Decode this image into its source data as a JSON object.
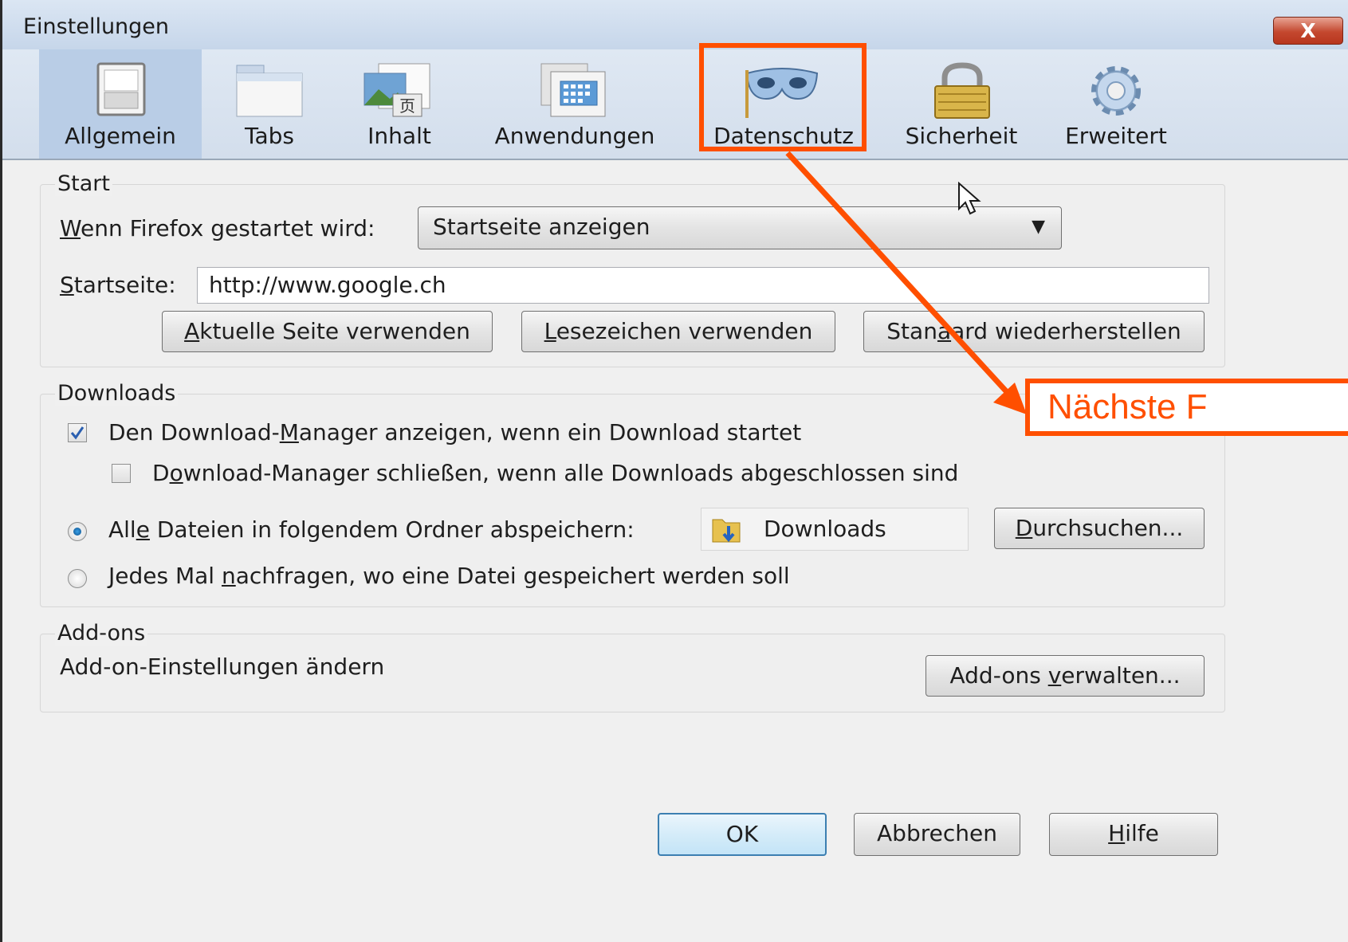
{
  "window": {
    "title": "Einstellungen",
    "close_label": "X"
  },
  "toolbar": {
    "tabs": [
      {
        "label": "Allgemein",
        "icon": "switch-icon",
        "selected": true
      },
      {
        "label": "Tabs",
        "icon": "tabs-window-icon",
        "selected": false
      },
      {
        "label": "Inhalt",
        "icon": "content-image-icon",
        "selected": false
      },
      {
        "label": "Anwendungen",
        "icon": "applications-calendar-icon",
        "selected": false
      },
      {
        "label": "Datenschutz",
        "icon": "privacy-mask-icon",
        "selected": false
      },
      {
        "label": "Sicherheit",
        "icon": "padlock-icon",
        "selected": false
      },
      {
        "label": "Erweitert",
        "icon": "gear-icon",
        "selected": false
      }
    ]
  },
  "start": {
    "legend": "Start",
    "when_label": "Wenn Firefox gestartet wird:",
    "when_value": "Startseite anzeigen",
    "homepage_label": "Startseite:",
    "homepage_value": "http://www.google.ch",
    "btn_current": "Aktuelle Seite verwenden",
    "btn_bookmark": "Lesezeichen verwenden",
    "btn_default": "Standard wiederherstellen"
  },
  "downloads": {
    "legend": "Downloads",
    "show_manager": "Den Download-Manager anzeigen, wenn ein Download startet",
    "show_manager_checked": true,
    "close_manager": "Download-Manager schließen, wenn alle Downloads abgeschlossen sind",
    "close_manager_checked": false,
    "save_to": "Alle Dateien in folgendem Ordner abspeichern:",
    "folder": "Downloads",
    "browse": "Durchsuchen...",
    "ask_each": "Jedes Mal nachfragen, wo eine Datei gespeichert werden soll"
  },
  "addons": {
    "legend": "Add-ons",
    "text": "Add-on-Einstellungen ändern",
    "manage": "Add-ons verwalten..."
  },
  "footer": {
    "ok": "OK",
    "cancel": "Abbrechen",
    "help": "Hilfe"
  },
  "annotation": {
    "label": "Nächste F",
    "color": "#ff4f00"
  }
}
